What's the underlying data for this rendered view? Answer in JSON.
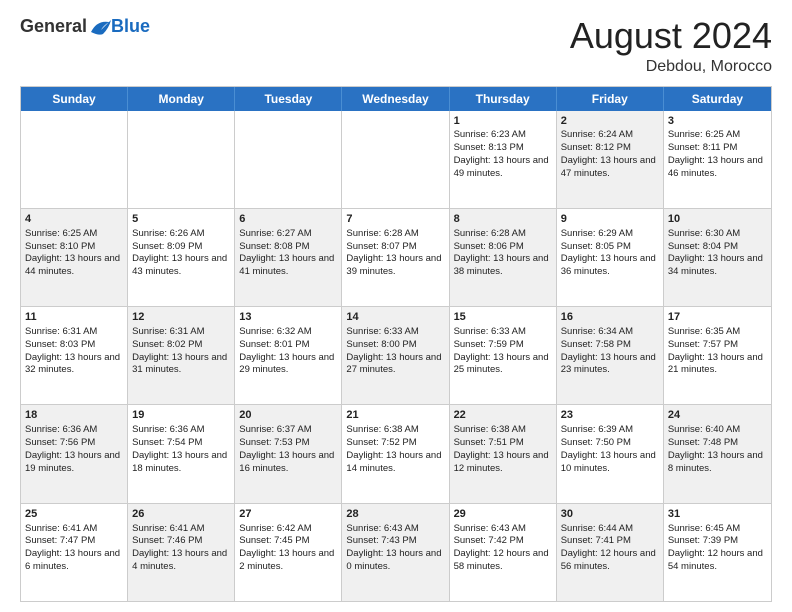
{
  "logo": {
    "general": "General",
    "blue": "Blue"
  },
  "title": {
    "month_year": "August 2024",
    "location": "Debdou, Morocco"
  },
  "header_days": [
    "Sunday",
    "Monday",
    "Tuesday",
    "Wednesday",
    "Thursday",
    "Friday",
    "Saturday"
  ],
  "rows": [
    [
      {
        "day": "",
        "info": "",
        "shaded": false
      },
      {
        "day": "",
        "info": "",
        "shaded": false
      },
      {
        "day": "",
        "info": "",
        "shaded": false
      },
      {
        "day": "",
        "info": "",
        "shaded": false
      },
      {
        "day": "1",
        "info": "Sunrise: 6:23 AM\nSunset: 8:13 PM\nDaylight: 13 hours and 49 minutes.",
        "shaded": false
      },
      {
        "day": "2",
        "info": "Sunrise: 6:24 AM\nSunset: 8:12 PM\nDaylight: 13 hours and 47 minutes.",
        "shaded": true
      },
      {
        "day": "3",
        "info": "Sunrise: 6:25 AM\nSunset: 8:11 PM\nDaylight: 13 hours and 46 minutes.",
        "shaded": false
      }
    ],
    [
      {
        "day": "4",
        "info": "Sunrise: 6:25 AM\nSunset: 8:10 PM\nDaylight: 13 hours and 44 minutes.",
        "shaded": true
      },
      {
        "day": "5",
        "info": "Sunrise: 6:26 AM\nSunset: 8:09 PM\nDaylight: 13 hours and 43 minutes.",
        "shaded": false
      },
      {
        "day": "6",
        "info": "Sunrise: 6:27 AM\nSunset: 8:08 PM\nDaylight: 13 hours and 41 minutes.",
        "shaded": true
      },
      {
        "day": "7",
        "info": "Sunrise: 6:28 AM\nSunset: 8:07 PM\nDaylight: 13 hours and 39 minutes.",
        "shaded": false
      },
      {
        "day": "8",
        "info": "Sunrise: 6:28 AM\nSunset: 8:06 PM\nDaylight: 13 hours and 38 minutes.",
        "shaded": true
      },
      {
        "day": "9",
        "info": "Sunrise: 6:29 AM\nSunset: 8:05 PM\nDaylight: 13 hours and 36 minutes.",
        "shaded": false
      },
      {
        "day": "10",
        "info": "Sunrise: 6:30 AM\nSunset: 8:04 PM\nDaylight: 13 hours and 34 minutes.",
        "shaded": true
      }
    ],
    [
      {
        "day": "11",
        "info": "Sunrise: 6:31 AM\nSunset: 8:03 PM\nDaylight: 13 hours and 32 minutes.",
        "shaded": false
      },
      {
        "day": "12",
        "info": "Sunrise: 6:31 AM\nSunset: 8:02 PM\nDaylight: 13 hours and 31 minutes.",
        "shaded": true
      },
      {
        "day": "13",
        "info": "Sunrise: 6:32 AM\nSunset: 8:01 PM\nDaylight: 13 hours and 29 minutes.",
        "shaded": false
      },
      {
        "day": "14",
        "info": "Sunrise: 6:33 AM\nSunset: 8:00 PM\nDaylight: 13 hours and 27 minutes.",
        "shaded": true
      },
      {
        "day": "15",
        "info": "Sunrise: 6:33 AM\nSunset: 7:59 PM\nDaylight: 13 hours and 25 minutes.",
        "shaded": false
      },
      {
        "day": "16",
        "info": "Sunrise: 6:34 AM\nSunset: 7:58 PM\nDaylight: 13 hours and 23 minutes.",
        "shaded": true
      },
      {
        "day": "17",
        "info": "Sunrise: 6:35 AM\nSunset: 7:57 PM\nDaylight: 13 hours and 21 minutes.",
        "shaded": false
      }
    ],
    [
      {
        "day": "18",
        "info": "Sunrise: 6:36 AM\nSunset: 7:56 PM\nDaylight: 13 hours and 19 minutes.",
        "shaded": true
      },
      {
        "day": "19",
        "info": "Sunrise: 6:36 AM\nSunset: 7:54 PM\nDaylight: 13 hours and 18 minutes.",
        "shaded": false
      },
      {
        "day": "20",
        "info": "Sunrise: 6:37 AM\nSunset: 7:53 PM\nDaylight: 13 hours and 16 minutes.",
        "shaded": true
      },
      {
        "day": "21",
        "info": "Sunrise: 6:38 AM\nSunset: 7:52 PM\nDaylight: 13 hours and 14 minutes.",
        "shaded": false
      },
      {
        "day": "22",
        "info": "Sunrise: 6:38 AM\nSunset: 7:51 PM\nDaylight: 13 hours and 12 minutes.",
        "shaded": true
      },
      {
        "day": "23",
        "info": "Sunrise: 6:39 AM\nSunset: 7:50 PM\nDaylight: 13 hours and 10 minutes.",
        "shaded": false
      },
      {
        "day": "24",
        "info": "Sunrise: 6:40 AM\nSunset: 7:48 PM\nDaylight: 13 hours and 8 minutes.",
        "shaded": true
      }
    ],
    [
      {
        "day": "25",
        "info": "Sunrise: 6:41 AM\nSunset: 7:47 PM\nDaylight: 13 hours and 6 minutes.",
        "shaded": false
      },
      {
        "day": "26",
        "info": "Sunrise: 6:41 AM\nSunset: 7:46 PM\nDaylight: 13 hours and 4 minutes.",
        "shaded": true
      },
      {
        "day": "27",
        "info": "Sunrise: 6:42 AM\nSunset: 7:45 PM\nDaylight: 13 hours and 2 minutes.",
        "shaded": false
      },
      {
        "day": "28",
        "info": "Sunrise: 6:43 AM\nSunset: 7:43 PM\nDaylight: 13 hours and 0 minutes.",
        "shaded": true
      },
      {
        "day": "29",
        "info": "Sunrise: 6:43 AM\nSunset: 7:42 PM\nDaylight: 12 hours and 58 minutes.",
        "shaded": false
      },
      {
        "day": "30",
        "info": "Sunrise: 6:44 AM\nSunset: 7:41 PM\nDaylight: 12 hours and 56 minutes.",
        "shaded": true
      },
      {
        "day": "31",
        "info": "Sunrise: 6:45 AM\nSunset: 7:39 PM\nDaylight: 12 hours and 54 minutes.",
        "shaded": false
      }
    ]
  ]
}
